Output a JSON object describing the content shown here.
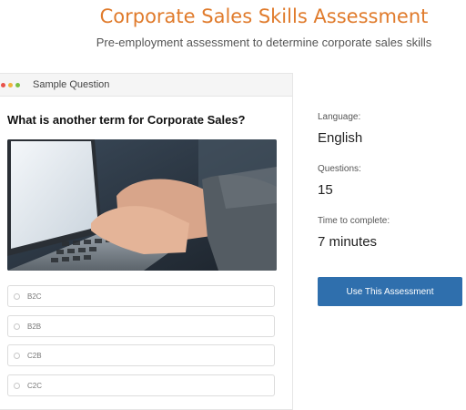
{
  "header": {
    "title": "Corporate Sales Skills Assessment",
    "subtitle": "Pre-employment assessment to determine corporate sales skills"
  },
  "sample_card": {
    "header_label": "Sample Question",
    "window_dots": [
      "#e8524a",
      "#f0b43c",
      "#7ac043"
    ],
    "question": "What is another term for Corporate Sales?",
    "options": [
      "B2C",
      "B2B",
      "C2B",
      "C2C"
    ]
  },
  "details": {
    "language_label": "Language:",
    "language_value": "English",
    "questions_label": "Questions:",
    "questions_value": "15",
    "time_label": "Time to complete:",
    "time_value": "7 minutes"
  },
  "actions": {
    "use_label": "Use This Assessment"
  },
  "colors": {
    "title": "#e07b2c",
    "button": "#2f6fad"
  }
}
